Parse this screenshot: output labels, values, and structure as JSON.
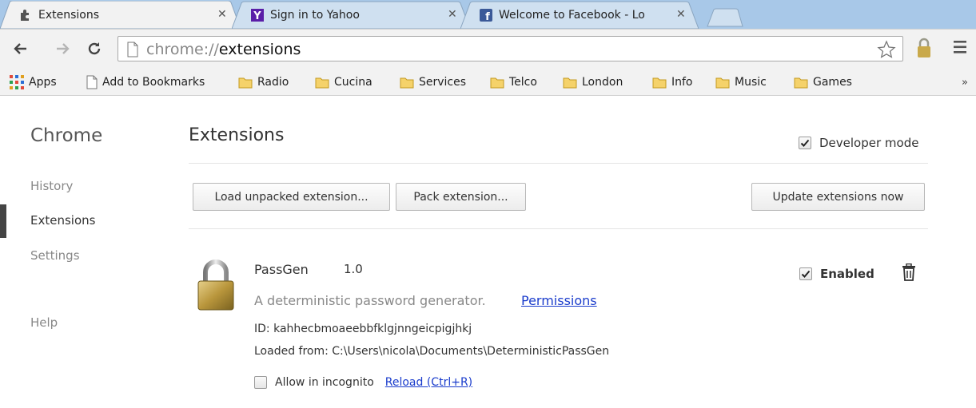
{
  "tabs": [
    {
      "title": "Extensions",
      "icon": "puzzle-icon",
      "active": true
    },
    {
      "title": "Sign in to Yahoo",
      "icon": "yahoo-icon",
      "active": false
    },
    {
      "title": "Welcome to Facebook - Lo",
      "icon": "facebook-icon",
      "active": false
    }
  ],
  "toolbar": {
    "url_scheme": "chrome://",
    "url_host": "extensions"
  },
  "bookmarks": {
    "items": [
      {
        "label": "Apps",
        "icon": "apps-grid-icon"
      },
      {
        "label": "Add to Bookmarks",
        "icon": "page-icon"
      },
      {
        "label": "Radio",
        "icon": "folder-icon"
      },
      {
        "label": "Cucina",
        "icon": "folder-icon"
      },
      {
        "label": "Services",
        "icon": "folder-icon"
      },
      {
        "label": "Telco",
        "icon": "folder-icon"
      },
      {
        "label": "London",
        "icon": "folder-icon"
      },
      {
        "label": "Info",
        "icon": "folder-icon"
      },
      {
        "label": "Music",
        "icon": "folder-icon"
      },
      {
        "label": "Games",
        "icon": "folder-icon"
      }
    ],
    "overflow": "»"
  },
  "sidebar": {
    "title": "Chrome",
    "items": [
      {
        "label": "History"
      },
      {
        "label": "Extensions",
        "active": true
      },
      {
        "label": "Settings"
      },
      {
        "label": "Help"
      }
    ]
  },
  "main": {
    "title": "Extensions",
    "developer_mode_label": "Developer mode",
    "developer_mode_checked": true,
    "buttons": {
      "load_unpacked": "Load unpacked extension...",
      "pack": "Pack extension...",
      "update": "Update extensions now"
    },
    "extension": {
      "name": "PassGen",
      "version": "1.0",
      "description": "A deterministic password generator.",
      "permissions_link": "Permissions",
      "id_line": "ID: kahhecbmoaeebbfklgjnngeicpigjhkj",
      "loaded_from": "Loaded from: C:\\Users\\nicola\\Documents\\DeterministicPassGen",
      "incognito_label": "Allow in incognito",
      "incognito_checked": false,
      "reload_link": "Reload (Ctrl+R)",
      "enabled_label": "Enabled",
      "enabled_checked": true
    }
  },
  "colors": {
    "tabstrip": "#a8c8e8",
    "toolbar": "#f2f2f2",
    "link": "#1a3ccc",
    "folder": "#e8b838"
  }
}
